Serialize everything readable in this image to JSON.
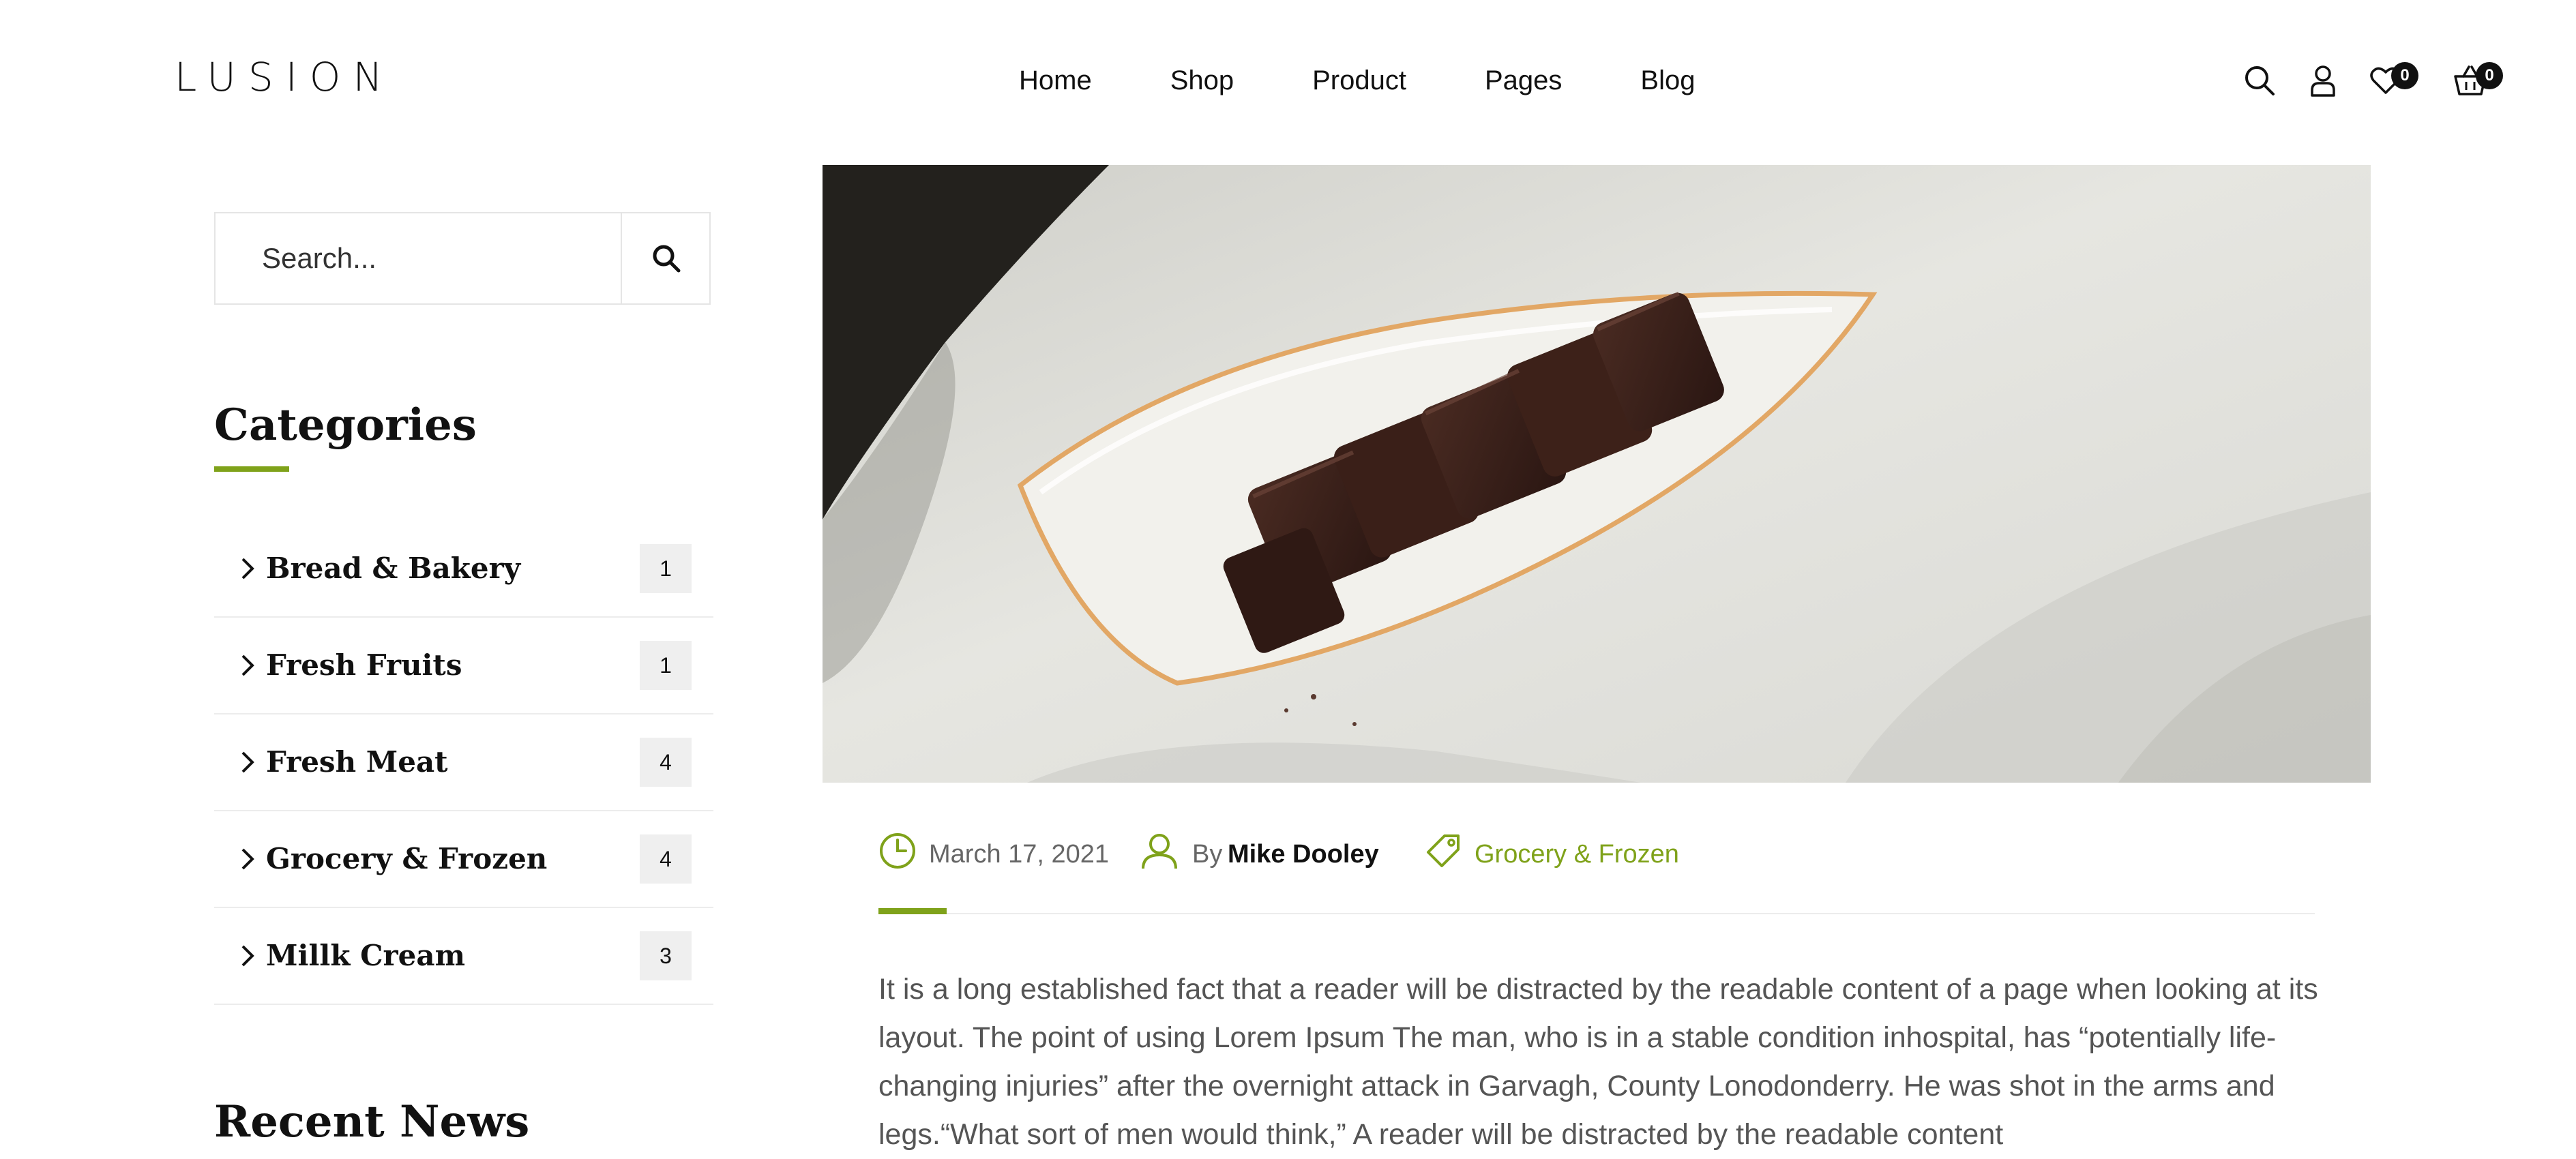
{
  "header": {
    "logo": "LUSION",
    "nav": [
      "Home",
      "Shop",
      "Product",
      "Pages",
      "Blog"
    ],
    "wishlist_count": "0",
    "cart_count": "0",
    "icons": [
      "search-icon",
      "user-icon",
      "heart-icon",
      "basket-icon"
    ]
  },
  "sidebar": {
    "search": {
      "placeholder": "Search..."
    },
    "categories_title": "Categories",
    "categories": [
      {
        "label": "Bread & Bakery",
        "count": "1"
      },
      {
        "label": "Fresh Fruits",
        "count": "1"
      },
      {
        "label": "Fresh Meat",
        "count": "4"
      },
      {
        "label": "Grocery & Frozen",
        "count": "4"
      },
      {
        "label": "Millk Cream",
        "count": "3"
      }
    ],
    "recent_news_title": "Recent News"
  },
  "post": {
    "date": "March 17, 2021",
    "by": "By",
    "author": "Mike Dooley",
    "category": "Grocery & Frozen",
    "body": "It is a long established fact that a reader will be distracted by the readable content of a page when looking at its layout. The point of using Lorem Ipsum The man, who is in a stable condition inhospital, has “potentially life-changing injuries” after the overnight attack in Garvagh, County Lonodonderry. He was shot in the arms and legs.“What sort of men would think,” A reader will be distracted by the readable content"
  },
  "colors": {
    "accent": "#7fa21a",
    "text": "#111111",
    "muted": "#666666"
  }
}
